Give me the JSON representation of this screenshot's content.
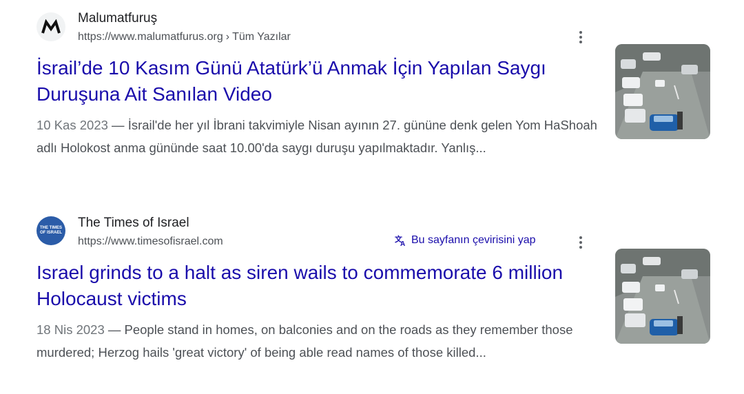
{
  "results": [
    {
      "site_name": "Malumatfuruş",
      "url": "https://www.malumatfurus.org",
      "breadcrumb": "Tüm Yazılar",
      "title_line1": "İsrail’de 10 Kasım Günü Atatürk’ü Anmak İçin Yapılan Saygı",
      "title_line2": "Duruşuna Ait Sanılan Video",
      "date": "10 Kas 2023",
      "dash": " — ",
      "snippet": "İsrail'de her yıl İbrani takvimiyle Nisan ayının 27. gününe denk gelen Yom HaShoah adlı Holokost anma gününde saat 10.00'da saygı duruşu yapılmaktadır. Yanlış...",
      "favicon_icon": "malumatfurus-logo-icon"
    },
    {
      "site_name": "The Times of Israel",
      "url": "https://www.timesofisrael.com",
      "translate_label": "Bu sayfanın çevirisini yap",
      "title_line1": "Israel grinds to a halt as siren wails to commemorate 6 million",
      "title_line2": "Holocaust victims",
      "date": "18 Nis 2023",
      "dash": " — ",
      "snippet": "People stand in homes, on balconies and on the roads as they remember those murdered; Herzog hails 'great victory' of being able read names of those killed...",
      "favicon_text_1": "THE TIMES",
      "favicon_text_2": "OF ISRAEL",
      "favicon_icon": "times-of-israel-logo-icon"
    }
  ],
  "colors": {
    "link": "#1a0dab",
    "text": "#202124",
    "muted": "#4d5156",
    "favicon_blue": "#2b5ca8"
  }
}
